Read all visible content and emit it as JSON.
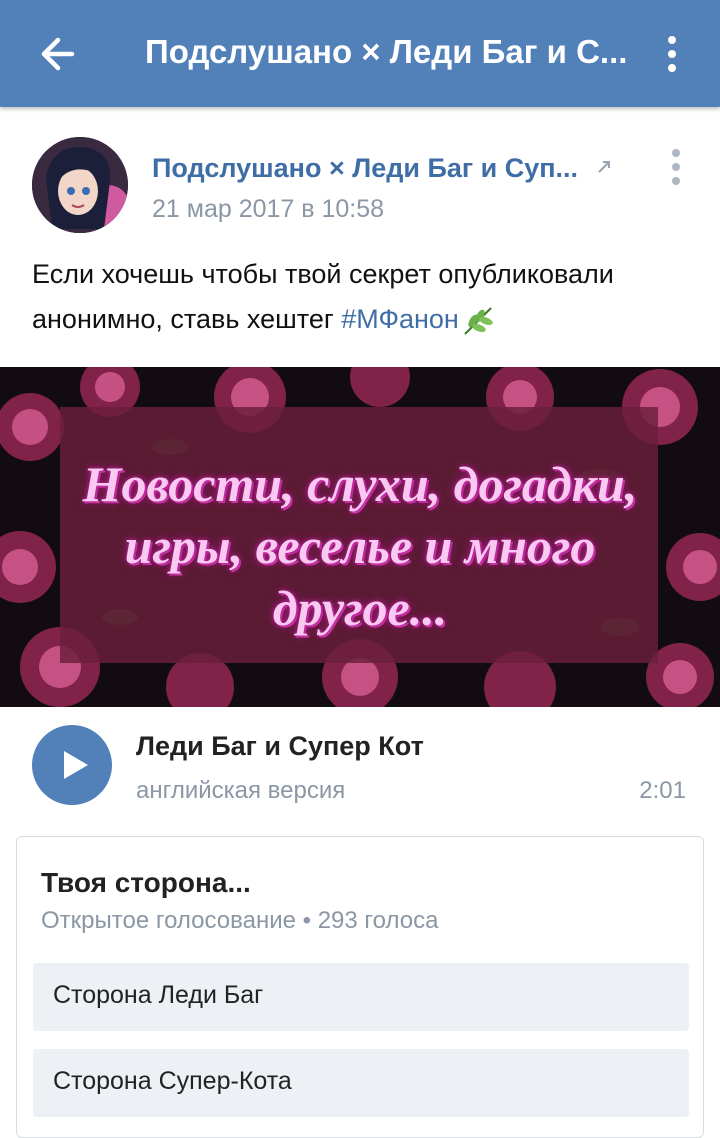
{
  "appbar": {
    "title": "Подслушано × Леди Баг и С..."
  },
  "post": {
    "group_name": "Подслушано × Леди Баг и Суп...",
    "date": "21 мар 2017 в 10:58",
    "text_line1": "Если хочешь чтобы твой секрет опубликовали",
    "text_line2": "анонимно, ставь хештег ",
    "hashtag": "#МФанон"
  },
  "banner": {
    "line1": "Новости, слухи, догадки,",
    "line2": "игры, веселье и много",
    "line3": "другое..."
  },
  "audio": {
    "title": "Леди Баг и Супер Кот",
    "artist": "английская версия",
    "duration": "2:01"
  },
  "poll": {
    "question": "Твоя сторона...",
    "meta": "Открытое голосование • 293 голоса",
    "options": [
      {
        "label": "Сторона Леди Баг"
      },
      {
        "label": "Сторона Супер-Кота"
      }
    ]
  },
  "colors": {
    "brand": "#5181b8",
    "link": "#3f6ea6",
    "muted": "#8b97a4"
  }
}
